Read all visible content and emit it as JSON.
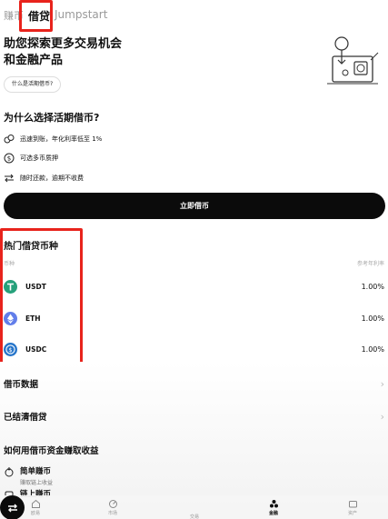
{
  "tabs": [
    {
      "label": "赚币"
    },
    {
      "label": "借贷"
    },
    {
      "label": "Jumpstart"
    }
  ],
  "hero": {
    "title_line1": "助您探索更多交易机会",
    "title_line2": "和金融产品",
    "link": "什么是活期借币?"
  },
  "why": {
    "title": "为什么选择活期借币?",
    "features": [
      {
        "icon": "coins-icon",
        "text": "迅速到账，年化利率低至 1%"
      },
      {
        "icon": "dollar-circle-icon",
        "text": "可选多币质押"
      },
      {
        "icon": "swap-arrows-icon",
        "text": "随时还款，逾期不收费"
      }
    ]
  },
  "cta_label": "立即借币",
  "hot": {
    "title": "热门借贷币种",
    "col_coin": "币种",
    "col_rate": "参考年利率",
    "coins": [
      {
        "name": "USDT",
        "rate": "1.00%",
        "color": "#26a17b",
        "icon": "usdt-icon"
      },
      {
        "name": "ETH",
        "rate": "1.00%",
        "color": "#627eea",
        "icon": "eth-icon"
      },
      {
        "name": "USDC",
        "rate": "1.00%",
        "color": "#2775ca",
        "icon": "usdc-icon"
      }
    ]
  },
  "rows": [
    {
      "label": "借币数据"
    },
    {
      "label": "已结清借贷"
    }
  ],
  "earn": {
    "title": "如何用借币资金赚取收益",
    "items": [
      {
        "title": "简单赚币",
        "sub": "赚取链上收益"
      },
      {
        "title": "链上赚币",
        "sub": ""
      }
    ]
  },
  "bottom_nav": [
    {
      "label": "欧易",
      "icon": "home-icon"
    },
    {
      "label": "市场",
      "icon": "market-icon"
    },
    {
      "label": "交易",
      "icon": "trade-icon"
    },
    {
      "label": "金融",
      "icon": "finance-icon"
    },
    {
      "label": "资产",
      "icon": "assets-icon"
    }
  ],
  "colors": {
    "accent": "#0b0b0b",
    "highlight": "#e8231c"
  }
}
